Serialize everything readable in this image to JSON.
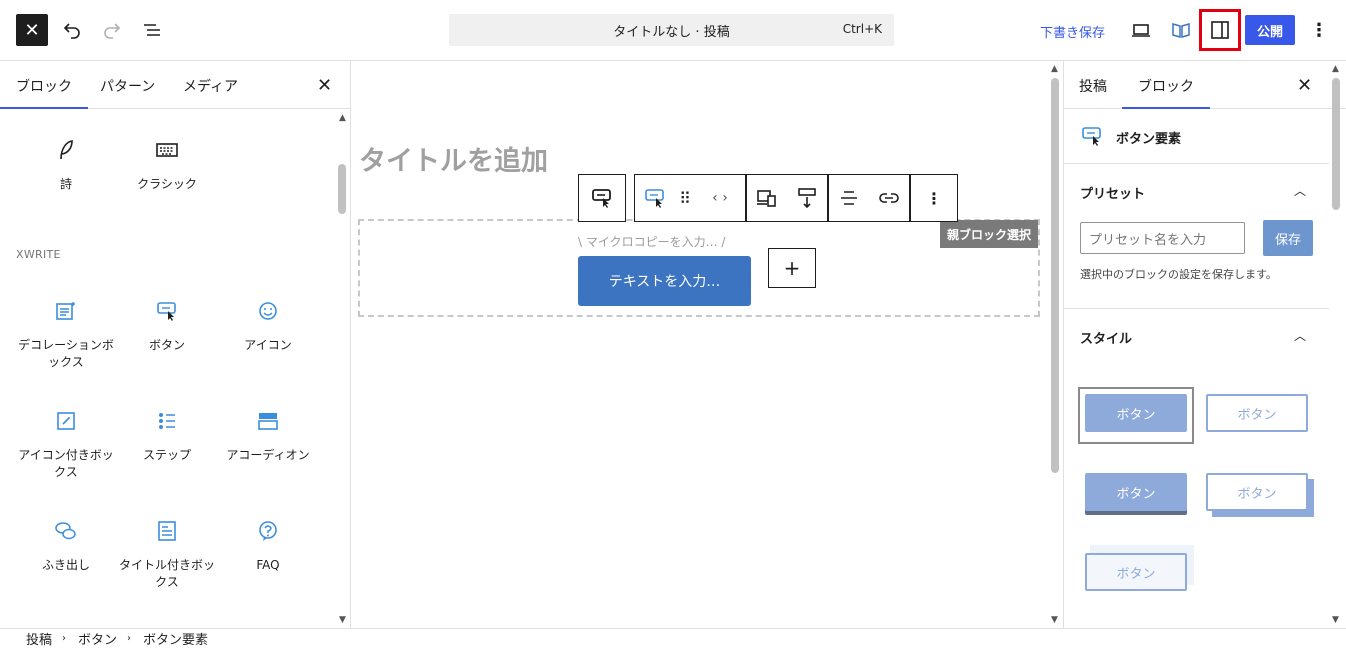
{
  "topbar": {
    "command_title": "タイトルなし · 投稿",
    "command_shortcut": "Ctrl+K",
    "save_draft": "下書き保存",
    "publish": "公開"
  },
  "inserter": {
    "tabs": [
      "ブロック",
      "パターン",
      "メディア"
    ],
    "blocks_top": [
      "詩",
      "クラシック"
    ],
    "category": "XWRITE",
    "blocks": [
      "デコレーションボックス",
      "ボタン",
      "アイコン",
      "アイコン付きボックス",
      "ステップ",
      "アコーディオン",
      "ふき出し",
      "タイトル付きボックス",
      "FAQ"
    ]
  },
  "canvas": {
    "title_placeholder": "タイトルを追加",
    "microcopy_placeholder": "\\ マイクロコピーを入力… /",
    "button_placeholder": "テキストを入力…",
    "parent_select": "親ブロック選択"
  },
  "sidebar": {
    "tabs": [
      "投稿",
      "ブロック"
    ],
    "block_name": "ボタン要素",
    "preset": {
      "heading": "プリセット",
      "placeholder": "プリセット名を入力",
      "save": "保存",
      "hint": "選択中のブロックの設定を保存します。"
    },
    "style": {
      "heading": "スタイル",
      "label": "ボタン"
    }
  },
  "breadcrumb": [
    "投稿",
    "ボタン",
    "ボタン要素"
  ],
  "colors": {
    "accent": "#3858e9",
    "button": "#3c74c2",
    "highlight": "#e00010"
  }
}
